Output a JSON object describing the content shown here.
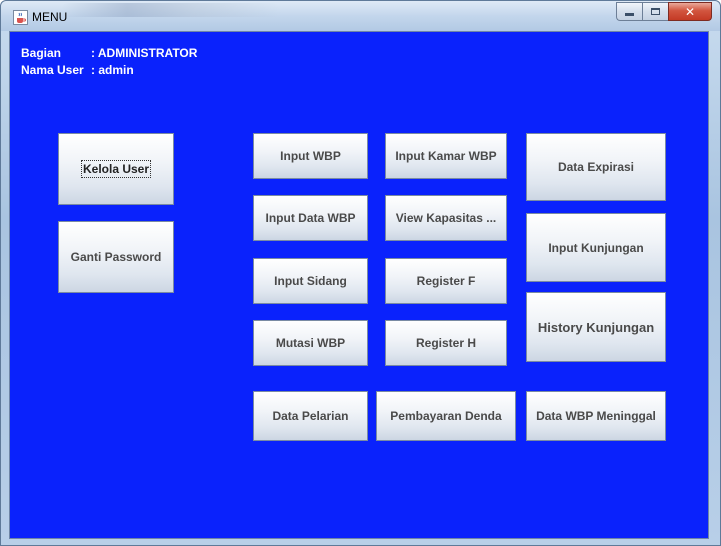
{
  "window": {
    "title": "MENU",
    "icon": "java-cup-icon",
    "controls": {
      "minimize": "minimize-icon",
      "maximize": "maximize-icon",
      "close": "close-icon"
    }
  },
  "info": {
    "bagian_label": "Bagian",
    "bagian_value": ": ADMINISTRATOR",
    "user_label": "Nama User",
    "user_value": ": admin"
  },
  "buttons": {
    "kelola_user": "Kelola User",
    "ganti_password": "Ganti Password",
    "input_wbp": "Input WBP",
    "input_data_wbp": "Input Data WBP",
    "input_sidang": "Input Sidang",
    "mutasi_wbp": "Mutasi WBP",
    "data_pelarian": "Data Pelarian",
    "input_kamar_wbp": "Input Kamar WBP",
    "view_kapasitas": "View Kapasitas ...",
    "register_f": "Register F",
    "register_h": "Register H",
    "pembayaran_denda": "Pembayaran Denda",
    "data_expirasi": "Data Expirasi",
    "input_kunjungan": "Input Kunjungan",
    "history_kunjungan": "History Kunjungan",
    "data_wbp_meninggal": "Data WBP Meninggal"
  },
  "colors": {
    "content_bg": "#0a22fc",
    "text_on_bg": "#ffffff",
    "button_text": "#4a4a4a"
  }
}
